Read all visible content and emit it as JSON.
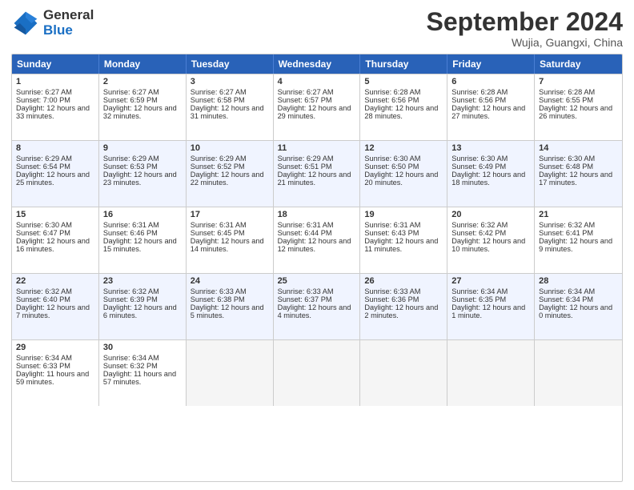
{
  "logo": {
    "general": "General",
    "blue": "Blue"
  },
  "header": {
    "month": "September 2024",
    "location": "Wujia, Guangxi, China"
  },
  "weekdays": [
    "Sunday",
    "Monday",
    "Tuesday",
    "Wednesday",
    "Thursday",
    "Friday",
    "Saturday"
  ],
  "weeks": [
    [
      {
        "day": "1",
        "sunrise": "6:27 AM",
        "sunset": "7:00 PM",
        "daylight": "12 hours and 33 minutes."
      },
      {
        "day": "2",
        "sunrise": "6:27 AM",
        "sunset": "6:59 PM",
        "daylight": "12 hours and 32 minutes."
      },
      {
        "day": "3",
        "sunrise": "6:27 AM",
        "sunset": "6:58 PM",
        "daylight": "12 hours and 31 minutes."
      },
      {
        "day": "4",
        "sunrise": "6:27 AM",
        "sunset": "6:57 PM",
        "daylight": "12 hours and 29 minutes."
      },
      {
        "day": "5",
        "sunrise": "6:28 AM",
        "sunset": "6:56 PM",
        "daylight": "12 hours and 28 minutes."
      },
      {
        "day": "6",
        "sunrise": "6:28 AM",
        "sunset": "6:56 PM",
        "daylight": "12 hours and 27 minutes."
      },
      {
        "day": "7",
        "sunrise": "6:28 AM",
        "sunset": "6:55 PM",
        "daylight": "12 hours and 26 minutes."
      }
    ],
    [
      {
        "day": "8",
        "sunrise": "6:29 AM",
        "sunset": "6:54 PM",
        "daylight": "12 hours and 25 minutes."
      },
      {
        "day": "9",
        "sunrise": "6:29 AM",
        "sunset": "6:53 PM",
        "daylight": "12 hours and 23 minutes."
      },
      {
        "day": "10",
        "sunrise": "6:29 AM",
        "sunset": "6:52 PM",
        "daylight": "12 hours and 22 minutes."
      },
      {
        "day": "11",
        "sunrise": "6:29 AM",
        "sunset": "6:51 PM",
        "daylight": "12 hours and 21 minutes."
      },
      {
        "day": "12",
        "sunrise": "6:30 AM",
        "sunset": "6:50 PM",
        "daylight": "12 hours and 20 minutes."
      },
      {
        "day": "13",
        "sunrise": "6:30 AM",
        "sunset": "6:49 PM",
        "daylight": "12 hours and 18 minutes."
      },
      {
        "day": "14",
        "sunrise": "6:30 AM",
        "sunset": "6:48 PM",
        "daylight": "12 hours and 17 minutes."
      }
    ],
    [
      {
        "day": "15",
        "sunrise": "6:30 AM",
        "sunset": "6:47 PM",
        "daylight": "12 hours and 16 minutes."
      },
      {
        "day": "16",
        "sunrise": "6:31 AM",
        "sunset": "6:46 PM",
        "daylight": "12 hours and 15 minutes."
      },
      {
        "day": "17",
        "sunrise": "6:31 AM",
        "sunset": "6:45 PM",
        "daylight": "12 hours and 14 minutes."
      },
      {
        "day": "18",
        "sunrise": "6:31 AM",
        "sunset": "6:44 PM",
        "daylight": "12 hours and 12 minutes."
      },
      {
        "day": "19",
        "sunrise": "6:31 AM",
        "sunset": "6:43 PM",
        "daylight": "12 hours and 11 minutes."
      },
      {
        "day": "20",
        "sunrise": "6:32 AM",
        "sunset": "6:42 PM",
        "daylight": "12 hours and 10 minutes."
      },
      {
        "day": "21",
        "sunrise": "6:32 AM",
        "sunset": "6:41 PM",
        "daylight": "12 hours and 9 minutes."
      }
    ],
    [
      {
        "day": "22",
        "sunrise": "6:32 AM",
        "sunset": "6:40 PM",
        "daylight": "12 hours and 7 minutes."
      },
      {
        "day": "23",
        "sunrise": "6:32 AM",
        "sunset": "6:39 PM",
        "daylight": "12 hours and 6 minutes."
      },
      {
        "day": "24",
        "sunrise": "6:33 AM",
        "sunset": "6:38 PM",
        "daylight": "12 hours and 5 minutes."
      },
      {
        "day": "25",
        "sunrise": "6:33 AM",
        "sunset": "6:37 PM",
        "daylight": "12 hours and 4 minutes."
      },
      {
        "day": "26",
        "sunrise": "6:33 AM",
        "sunset": "6:36 PM",
        "daylight": "12 hours and 2 minutes."
      },
      {
        "day": "27",
        "sunrise": "6:34 AM",
        "sunset": "6:35 PM",
        "daylight": "12 hours and 1 minute."
      },
      {
        "day": "28",
        "sunrise": "6:34 AM",
        "sunset": "6:34 PM",
        "daylight": "12 hours and 0 minutes."
      }
    ],
    [
      {
        "day": "29",
        "sunrise": "6:34 AM",
        "sunset": "6:33 PM",
        "daylight": "11 hours and 59 minutes."
      },
      {
        "day": "30",
        "sunrise": "6:34 AM",
        "sunset": "6:32 PM",
        "daylight": "11 hours and 57 minutes."
      },
      null,
      null,
      null,
      null,
      null
    ]
  ],
  "labels": {
    "sunrise": "Sunrise:",
    "sunset": "Sunset:",
    "daylight": "Daylight:"
  }
}
